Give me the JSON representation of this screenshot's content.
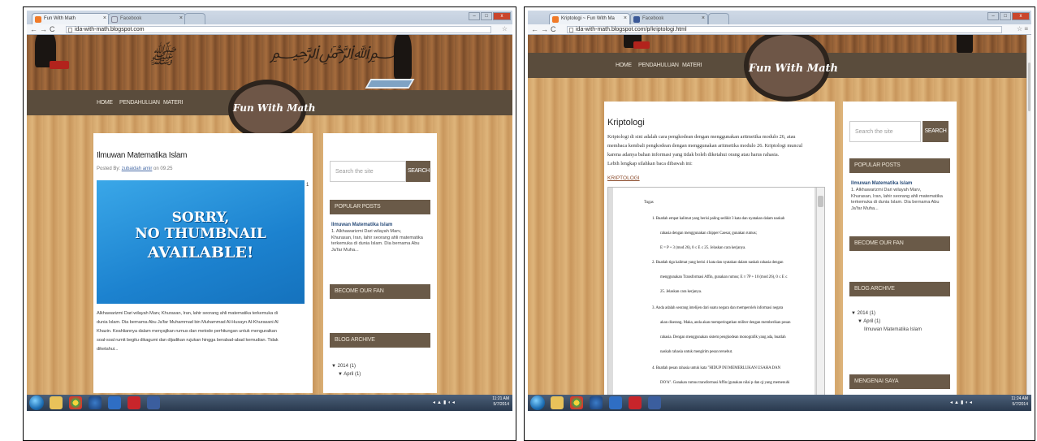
{
  "left": {
    "tabs": [
      {
        "label": "Fun With Math"
      },
      {
        "label": "Facebook"
      }
    ],
    "url": "ida-with-math.blogspot.com",
    "menu": [
      "HOME",
      "PENDAHULUAN",
      "MATERI"
    ],
    "site_title": "Fun With Math",
    "post": {
      "title": "Ilmuwan Matematika Islam",
      "posted_prefix": "Posted By:",
      "author": "zubaidah amir",
      "on": "on",
      "time": "09.25",
      "comment_count": "1",
      "thumbnail_lines": [
        "SORRY,",
        "NO THUMBNAIL",
        "AVAILABLE!"
      ],
      "body": [
        "Alkhawarizmi   Dari wilayah Marv, Khurasan, Iran, lahir seorang ahli matematika terkemuka di",
        "dunia Islam. Dia bernama Abu Ja'far Muhammad bin Muhammad Al-Husayn Al-Khurasani Al",
        "Khazin. Keahliannya dalam menyajikan rumus dan metode perhitungan untuk menguraikan",
        "soal-soal rumit begitu dikagumi dan dijadikan rujukan hingga berabad-abad kemudian. Tidak",
        "diketahui..."
      ]
    },
    "sidebar": {
      "search_placeholder": "Search the site",
      "search_button": "SEARCH",
      "popular_heading": "POPULAR POSTS",
      "popular_title": "Ilmuwan Matematika Islam",
      "popular_snippet": [
        "1. Alkhawarizmi   Dari wilayah Marv,",
        "Khurasan, Iran, lahir seorang ahli matematika",
        "terkemuka di dunia Islam. Dia bernama Abu",
        "Ja'far Muha..."
      ],
      "fan_heading": "BECOME OUR FAN",
      "archive_heading": "BLOG ARCHIVE",
      "archive_year": "▼  2014 (1)",
      "archive_month": "▼  April (1)"
    },
    "clock": {
      "time": "11:21 AM",
      "date": "5/7/2014"
    }
  },
  "right": {
    "tabs": [
      {
        "label": "Kriptologi ~ Fun With Ma"
      },
      {
        "label": "Facebook"
      }
    ],
    "url": "ida-with-math.blogspot.com/p/kriptologi.html",
    "menu": [
      "HOME",
      "PENDAHULUAN",
      "MATERI"
    ],
    "site_title": "Fun With Math",
    "page": {
      "title": "Kriptologi",
      "intro": [
        "Kriptologi di sini adalah cara pengkodean dengan menggunakan   aritmetika modulo 26, atau",
        "membaca kembali pengkodean dengan menggunakan aritmetika modulo 26. Kriptologi muncul",
        "karena adanya bahan informasi yang tidak boleh diketahui orang atau harus rahasia.",
        "Lebih lengkap silahkan baca dibawah ini:"
      ],
      "link": "KRIPTOLOGI",
      "doc_heading": "Tugas",
      "doc_lines": [
        "1.   Buatlah empat kalimat yang berisi paling sedikit 3 kata dan nyatakan dalam naskah",
        "rahasia     dengan     menggunakan     chipper     Caesar,     gunakan     rumus;",
        "E = P + 3 (mod 26), 0 ≤ E ≤ 25. Jelaskan cara kerjanya.",
        "2.   Buatlah tiga kalimat yang berisi 4 kata dan nyatakan dalam naskah rahasia dengan",
        "menggunakan Transformasi Affin, gunakan rumus; E ≡ 7P + 10 (mod 26), 0 ≤ E ≤",
        "25. Jelaskan cara kerjanya.",
        "3.   Anda adalah seorang intelijen dari suatu negara dan memperoleh informasi negara",
        "akan diserang. Maka, anda akan memperingatkan militer dengan memberikan pesan",
        "rahasia. Dengan menggunakan sistem pengkodean monografik yang ada, buatlah",
        "naskah rahasia untuk mengirim pesan tersebut.",
        "4.   Buatlah pesan rahasia untuk kata \"HIDUP INI MEMERLUKAN USAHA DAN",
        "DO'A\". Gunakan rumus transformasi Affin (gunakan nilai p dan q) yang memenuhi"
      ]
    },
    "sidebar": {
      "search_placeholder": "Search the site",
      "search_button": "SEARCH",
      "popular_heading": "POPULAR POSTS",
      "popular_title": "Ilmuwan Matematika Islam",
      "popular_snippet": [
        "1. Alkhawarizmi   Dari wilayah Marv,",
        "Khurasan, Iran, lahir seorang ahli matematika",
        "terkemuka di dunia Islam. Dia bernama Abu",
        "Ja'far Muha..."
      ],
      "fan_heading": "BECOME OUR FAN",
      "archive_heading": "BLOG ARCHIVE",
      "archive_year": "▼  2014 (1)",
      "archive_month": "▼  April (1)",
      "archive_post": "Ilmuwan Matematika Islam",
      "next_heading": "MENGENAI SAYA"
    },
    "clock": {
      "time": "11:24 AM",
      "date": "5/7/2014"
    }
  }
}
